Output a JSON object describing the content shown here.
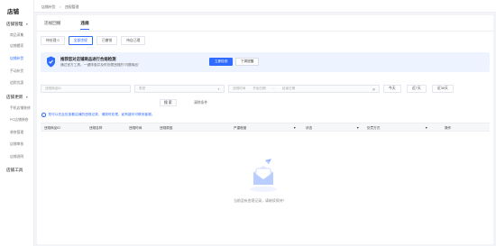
{
  "brand": "店铺",
  "sidebar": {
    "groups": [
      {
        "label": "店铺管理",
        "items": [
          "商品采集",
          "店铺搬家",
          "店铺补货",
          "手动补货",
          "追踪优惠"
        ]
      },
      {
        "label": "店铺更新",
        "items": [
          "手机店铺装修",
          "PC店铺装修",
          "装修管理",
          "店铺审核",
          "店铺说明"
        ]
      },
      {
        "label": "店铺工具",
        "items": []
      }
    ],
    "active_item": "店铺补货"
  },
  "breadcrumb": [
    "店铺补货",
    "违规管理"
  ],
  "tabs": [
    {
      "label": "违规回撤",
      "active": false
    },
    {
      "label": "违规",
      "active": true
    }
  ],
  "subtabs": [
    {
      "label": "待处理 0",
      "active": false
    },
    {
      "label": "全部违规",
      "active": true
    },
    {
      "label": "已撤销",
      "active": false
    },
    {
      "label": "待自己理",
      "active": false
    }
  ],
  "banner": {
    "title": "推荐您对店铺商品进行合规检测",
    "desc": "通过官方工具，一键排查并及时处理违规的\"问题商品\"",
    "primary_label": "立即检测",
    "secondary_label": "下周提醒"
  },
  "filters": {
    "product_placeholder": "违规商品ID",
    "type_placeholder": "类型",
    "time_label": "违规时间",
    "time_start": "开始日期",
    "time_end": "结束日期",
    "btn_today": "今天",
    "btn_week": "近7天",
    "btn_month": "近30天",
    "search_label": "搜 索",
    "reset_label": "清除条件"
  },
  "hint": "您可以在此处查看店铺的违规记录，请按时处理，如有疑问可联系客服。",
  "table": {
    "columns": [
      "违规商品ID",
      "违规名称",
      "违规时间",
      "违规原因",
      "严重程度",
      "状态",
      "处罚方式",
      "操作"
    ]
  },
  "empty_text": "当前没有违规记录，请继续保持！",
  "colors": {
    "accent": "#2f6bff",
    "banner_bg": "#eef4ff"
  }
}
